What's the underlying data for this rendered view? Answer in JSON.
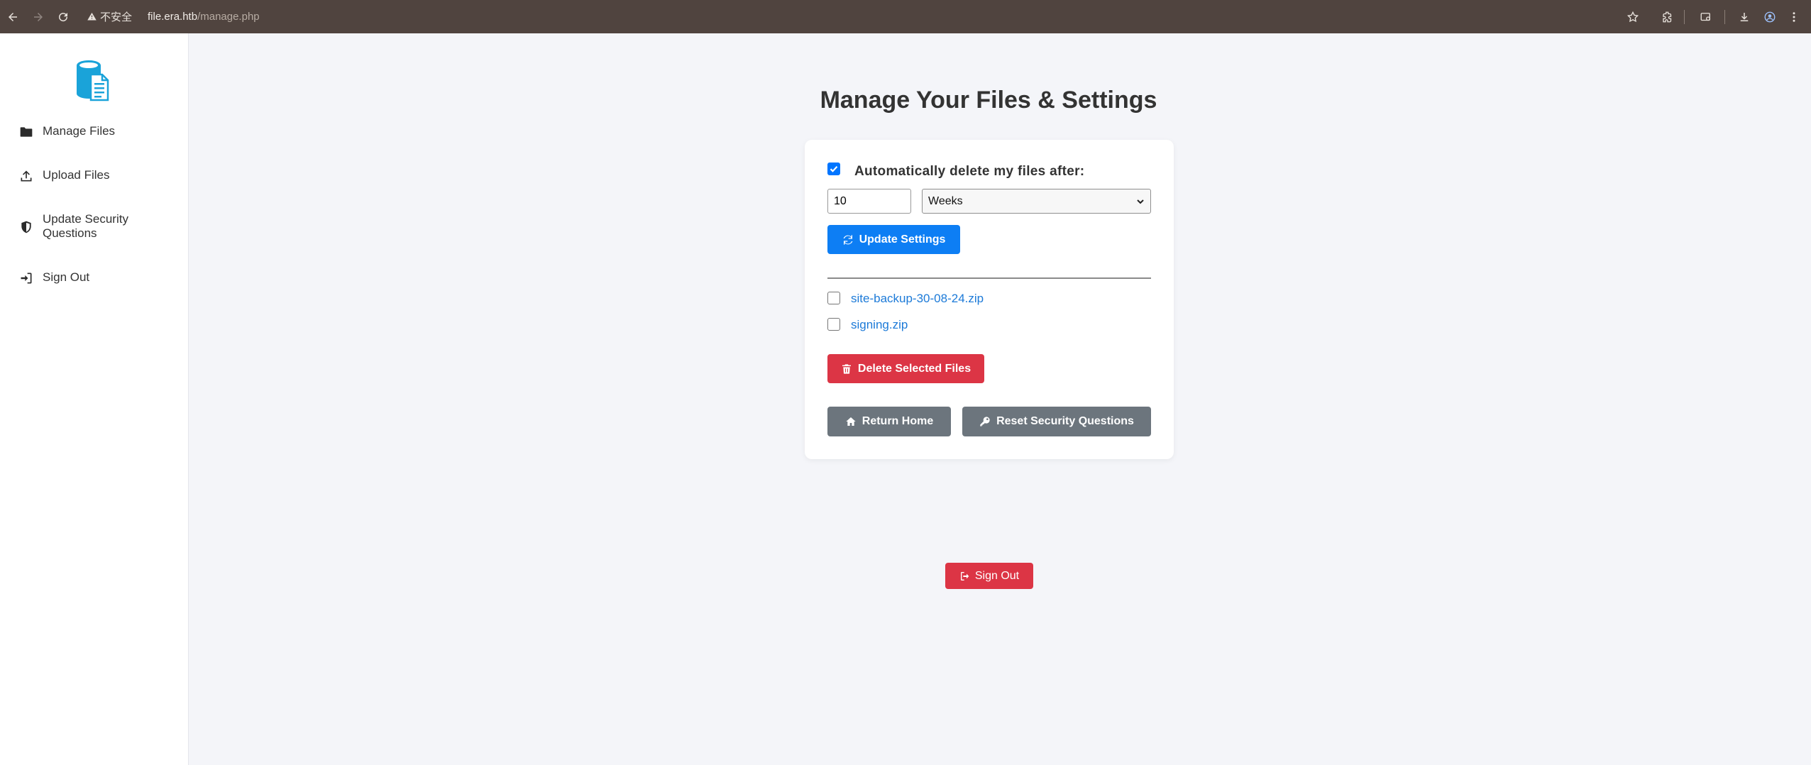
{
  "browser": {
    "security_label": "不安全",
    "url_host": "file.era.htb",
    "url_path": "/manage.php"
  },
  "sidebar": {
    "items": [
      {
        "label": "Manage Files",
        "icon": "folder-icon"
      },
      {
        "label": "Upload Files",
        "icon": "upload-icon"
      },
      {
        "label": "Update Security Questions",
        "icon": "shield-icon"
      },
      {
        "label": "Sign Out",
        "icon": "sign-in-icon"
      }
    ]
  },
  "main": {
    "title": "Manage Your Files & Settings",
    "settings": {
      "auto_delete_checked": true,
      "auto_delete_label": "Automatically delete my files after:",
      "duration_value": "10",
      "unit_selected": "Weeks",
      "update_button": "Update Settings"
    },
    "files": [
      {
        "name": "site-backup-30-08-24.zip",
        "checked": false
      },
      {
        "name": "signing.zip",
        "checked": false
      }
    ],
    "delete_button": "Delete Selected Files",
    "return_home_button": "Return Home",
    "reset_security_button": "Reset Security Questions",
    "sign_out_button": "Sign Out"
  },
  "colors": {
    "primary_blue": "#0d7ef4",
    "danger_red": "#dc3545",
    "secondary_gray": "#6c757d",
    "link_blue": "#1c7ad8",
    "logo_cyan": "#1aa3d9"
  }
}
